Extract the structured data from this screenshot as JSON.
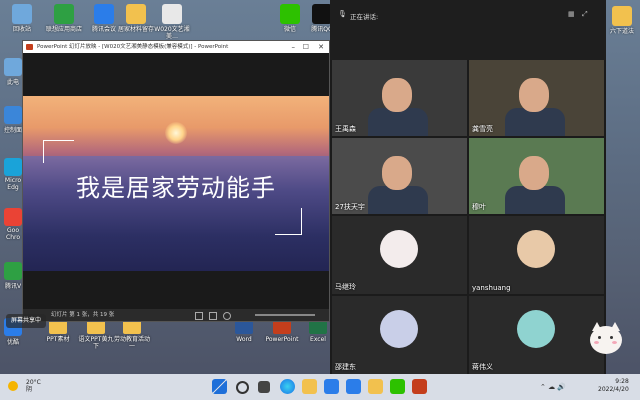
{
  "desktop_top_icons": [
    {
      "label": "回收站",
      "color": "#6fa8dc"
    },
    {
      "label": "联想应用商店",
      "color": "#2ea043"
    },
    {
      "label": "腾讯会议",
      "color": "#2b7de9"
    },
    {
      "label": "居家材料留存",
      "color": "#f2c14e"
    },
    {
      "label": "W020文艺湘美…",
      "color": "#e8e8e8"
    },
    {
      "label": "微信",
      "color": "#2dc100"
    },
    {
      "label": "腾讯QQ",
      "color": "#111111"
    }
  ],
  "desktop_top_right_label": "六下道法",
  "desktop_left_icons": [
    "此电",
    "控制面",
    "Micro Edg",
    "Goo Chro",
    "腾讯V",
    "优酷"
  ],
  "desktop_bottom_icons": [
    {
      "label": "PPT素材",
      "color": "#f2c14e"
    },
    {
      "label": "语文PPT黄九 下",
      "color": "#f2c14e"
    },
    {
      "label": "劳动教育活动 一",
      "color": "#f2c14e"
    },
    {
      "label": "Word",
      "color": "#2b579a"
    },
    {
      "label": "PowerPoint",
      "color": "#c43e1c"
    },
    {
      "label": "Excel",
      "color": "#217346"
    }
  ],
  "ppt": {
    "window_title": "PowerPoint 幻灯片放映 - [W020文艺湘美静态模板(兼容模式)] - PowerPoint",
    "slide_title": "我是居家劳动能手",
    "status_text": "幻灯片 第 1 张，共 19 张",
    "overlay_text": "屏幕共享中"
  },
  "meeting": {
    "speaking_label": "正在讲话:",
    "participants": [
      {
        "name": "王禹森",
        "video": true
      },
      {
        "name": "龚雪亮",
        "video": true
      },
      {
        "name": "27扶天宇",
        "video": true
      },
      {
        "name": "穆叶",
        "video": true
      },
      {
        "name": "马继玲",
        "video": false
      },
      {
        "name": "yanshuang",
        "video": false
      },
      {
        "name": "邵建东",
        "video": false
      },
      {
        "name": "蒋伟义",
        "video": false
      }
    ]
  },
  "taskbar": {
    "weather_temp": "20°C",
    "weather_desc": "阴",
    "time": "9:28",
    "date": "2022/4/20"
  }
}
